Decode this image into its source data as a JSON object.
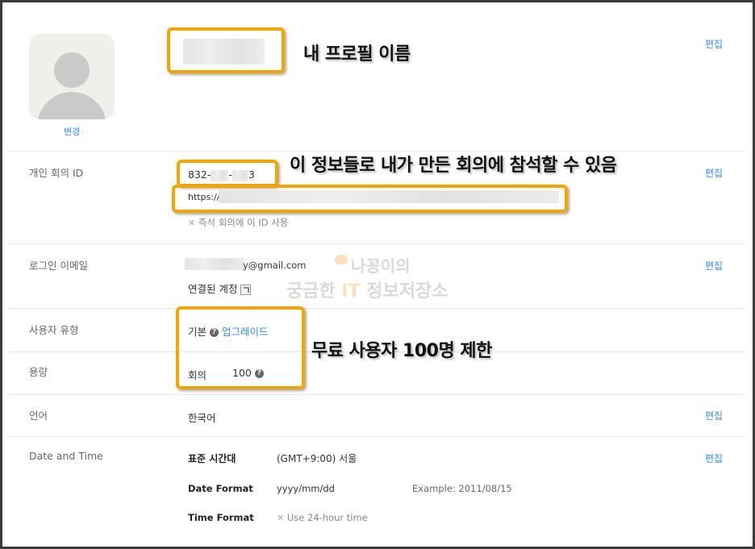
{
  "profile": {
    "change_label": "변경",
    "edit_label": "편집",
    "annotation": "내 프로필 이름"
  },
  "meeting_id": {
    "label": "개인 회의 ID",
    "id_prefix": "832-",
    "id_middle": "-",
    "id_suffix": "3",
    "url_prefix": "https://",
    "instant_option": "즉석 회의에 이 ID 사용",
    "edit_label": "편집",
    "annotation": "이 정보들로 내가 만든 회의에 참석할 수 있음"
  },
  "login_email": {
    "label": "로그인 이메일",
    "email_suffix": "y@gmail.com",
    "linked_account": "연결된 계정",
    "edit_label": "편집"
  },
  "user_type": {
    "label": "사용자 유형",
    "value": "기본",
    "upgrade": "업그레이드",
    "annotation": "무료 사용자 100명 제한"
  },
  "capacity": {
    "label": "용량",
    "meeting_label": "회의",
    "meeting_value": "100"
  },
  "language": {
    "label": "언어",
    "value": "한국어",
    "edit_label": "편집"
  },
  "date_time": {
    "label": "Date and Time",
    "timezone_label": "표준 시간대",
    "timezone_value": "(GMT+9:00) 서울",
    "date_format_label": "Date Format",
    "date_format_value": "yyyy/mm/dd",
    "date_example": "Example:  2011/08/15",
    "time_format_label": "Time Format",
    "time_format_value": "Use 24-hour time",
    "edit_label": "편집"
  },
  "watermark": {
    "line1": "나꽁이의",
    "line2_a": "궁금한 ",
    "line2_it": "IT",
    "line2_b": " 정보저장소"
  },
  "colors": {
    "highlight": "#f5a500",
    "link": "#2d8cff"
  }
}
